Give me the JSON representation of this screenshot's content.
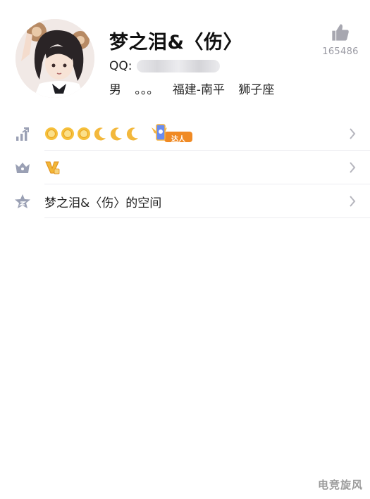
{
  "profile": {
    "name": "梦之泪&〈伤〉",
    "qq_label": "QQ:",
    "gender": "男",
    "status": "。。。",
    "location": "福建-南平",
    "zodiac": "狮子座",
    "like_count": "165486"
  },
  "rows": [
    {
      "icon": "level-icon",
      "badges": [
        "sun",
        "sun",
        "sun",
        "moon",
        "moon",
        "moon"
      ],
      "talent_label": "达人"
    },
    {
      "icon": "vip-crown-icon",
      "badges": [
        "gold-v"
      ]
    },
    {
      "icon": "star-icon",
      "label": "梦之泪&〈伤〉的空间"
    }
  ],
  "watermark": "电竞旋风",
  "colors": {
    "accent_gray": "#9a9aa3",
    "sun": "#f5b930",
    "moon": "#f3b83c",
    "talent_orange": "#f08a24"
  }
}
